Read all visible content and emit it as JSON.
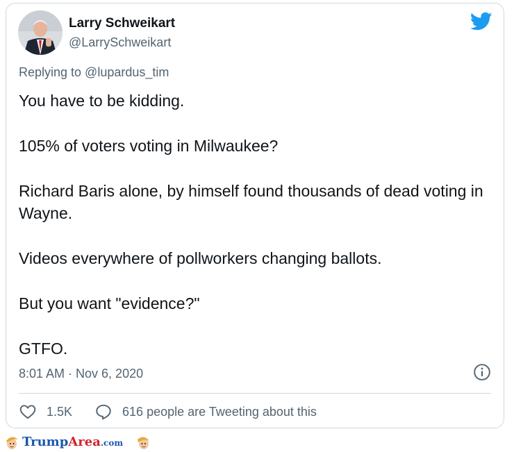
{
  "tweet": {
    "author_name": "Larry Schweikart",
    "author_handle": "@LarrySchweikart",
    "replying_to": "Replying to @lupardus_tim",
    "paragraphs": [
      "You have to be kidding.",
      "105% of voters voting in Milwaukee?",
      "Richard Baris alone, by himself found thousands of dead voting in Wayne.",
      "Videos everywhere of pollworkers changing ballots.",
      "But you want \"evidence?\"",
      "GTFO."
    ],
    "timestamp": "8:01 AM · Nov 6, 2020",
    "likes": "1.5K",
    "conversation": "616 people are Tweeting about this"
  },
  "icons": {
    "brand": "twitter-bird-icon",
    "info": "info-icon",
    "like": "heart-icon",
    "reply": "speech-bubble-icon"
  },
  "colors": {
    "twitter_blue": "#1d9bf0",
    "text_primary": "#0f1419",
    "text_secondary": "#536471",
    "border": "#cfd9de",
    "watermark_blue": "#1a56b0",
    "watermark_red": "#d4242a"
  },
  "watermark": {
    "part1": "Trump",
    "part2": "Area",
    "part3": ".com"
  }
}
